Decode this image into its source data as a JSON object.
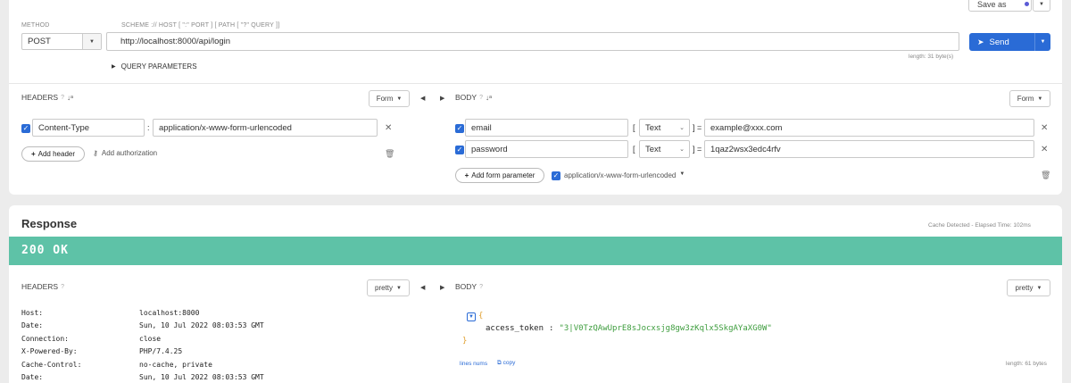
{
  "request": {
    "method_label": "METHOD",
    "method_value": "POST",
    "scheme_label": "SCHEME :// HOST [ \":\" PORT ] [ PATH [ \"?\" QUERY ]]",
    "url_value": "http://localhost:8000/api/login",
    "length_text": "length: 31 byte(s)",
    "save_as_label": "Save as",
    "send_label": "Send",
    "query_params_label": "QUERY PARAMETERS"
  },
  "headers_section": {
    "title": "HEADERS",
    "help": "?",
    "sort_icon": "↓a z",
    "format_label": "Form",
    "rows": [
      {
        "name": "Content-Type",
        "value": "application/x-www-form-urlencoded"
      }
    ],
    "add_header_label": "Add header",
    "add_auth_label": "Add authorization"
  },
  "body_section": {
    "title": "BODY",
    "help": "?",
    "format_label": "Form",
    "rows": [
      {
        "name": "email",
        "type": "Text",
        "value": "example@xxx.com"
      },
      {
        "name": "password",
        "type": "Text",
        "value": "1qaz2wsx3edc4rfv"
      }
    ],
    "add_param_label": "Add form parameter",
    "content_type_label": "application/x-www-form-urlencoded"
  },
  "response": {
    "title": "Response",
    "cache_text": "Cache Detected - Elapsed Time: 102ms",
    "status_text": "200 OK",
    "status_color": "#5ec2a7",
    "headers_title": "HEADERS",
    "headers_format": "pretty",
    "body_title": "BODY",
    "body_format": "pretty",
    "headers": [
      {
        "name": "Host:",
        "value": "localhost:8000"
      },
      {
        "name": "Date:",
        "value": "Sun, 10 Jul 2022 08:03:53 GMT"
      },
      {
        "name": "Connection:",
        "value": "close"
      },
      {
        "name": "X-Powered-By:",
        "value": "PHP/7.4.25"
      },
      {
        "name": "Cache-Control:",
        "value": "no-cache, private"
      },
      {
        "name": "Date:",
        "value": "Sun, 10 Jul 2022 08:03:53 GMT"
      }
    ],
    "json_open": "{",
    "json_key": "access_token",
    "json_sep": ":",
    "json_value": "\"3|V0TzQAwUprE8sJocxsjg8gw3zKqlx5SkgAYaXG0W\"",
    "json_close": "}",
    "line_nums_label": "lines nums",
    "copy_label": "copy",
    "body_length": "length: 61 bytes"
  },
  "colors": {
    "accent": "#2a6bd6",
    "status_green": "#5ec2a7",
    "json_string": "#3e9d3e"
  }
}
